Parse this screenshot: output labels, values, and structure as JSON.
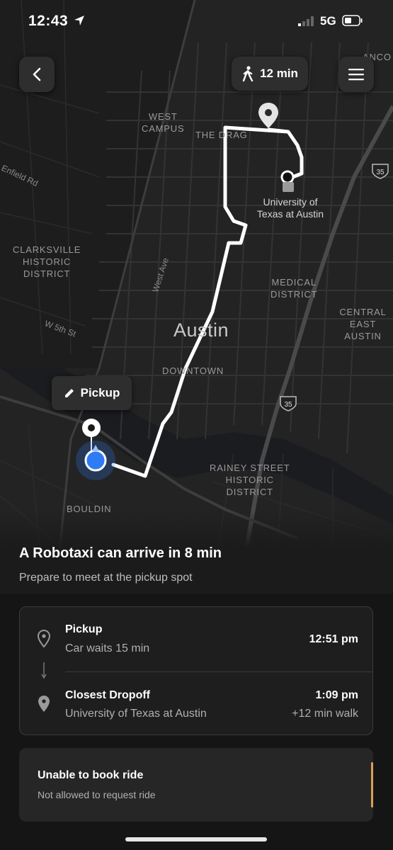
{
  "status_bar": {
    "time": "12:43",
    "network": "5G"
  },
  "map": {
    "walk_time": "12 min",
    "pickup_label": "Pickup",
    "labels": {
      "west_campus": "WEST\nCAMPUS",
      "the_drag": "THE DRAG",
      "university": "University of\nTexas at Austin",
      "clarksville": "CLARKSVILLE\nHISTORIC\nDISTRICT",
      "medical": "MEDICAL\nDISTRICT",
      "central_east": "CENTRAL\nEAST AUSTIN",
      "austin": "Austin",
      "downtown": "DOWNTOWN",
      "rainey": "RAINEY STREET\nHISTORIC\nDISTRICT",
      "bouldin": "BOULDIN",
      "west_ave": "West Ave",
      "w5th": "W 5th St",
      "enfield": "Enfield Rd",
      "anco": "ANCO"
    },
    "shields": [
      "35",
      "35"
    ]
  },
  "arrival": {
    "headline": "A Robotaxi can arrive in 8 min",
    "subtitle": "Prepare to meet at the pickup spot"
  },
  "trip": {
    "pickup": {
      "title": "Pickup",
      "subtitle": "Car waits 15 min",
      "time": "12:51 pm"
    },
    "dropoff": {
      "title": "Closest Dropoff",
      "subtitle": "University of Texas at Austin",
      "time": "1:09 pm",
      "walk": "+12 min walk"
    }
  },
  "booking": {
    "title": "Unable to book ride",
    "subtitle": "Not allowed to request ride"
  },
  "colors": {
    "accent_blue": "#2f7bf5",
    "route": "#ffffff",
    "warning_edge": "#d9a05b"
  }
}
